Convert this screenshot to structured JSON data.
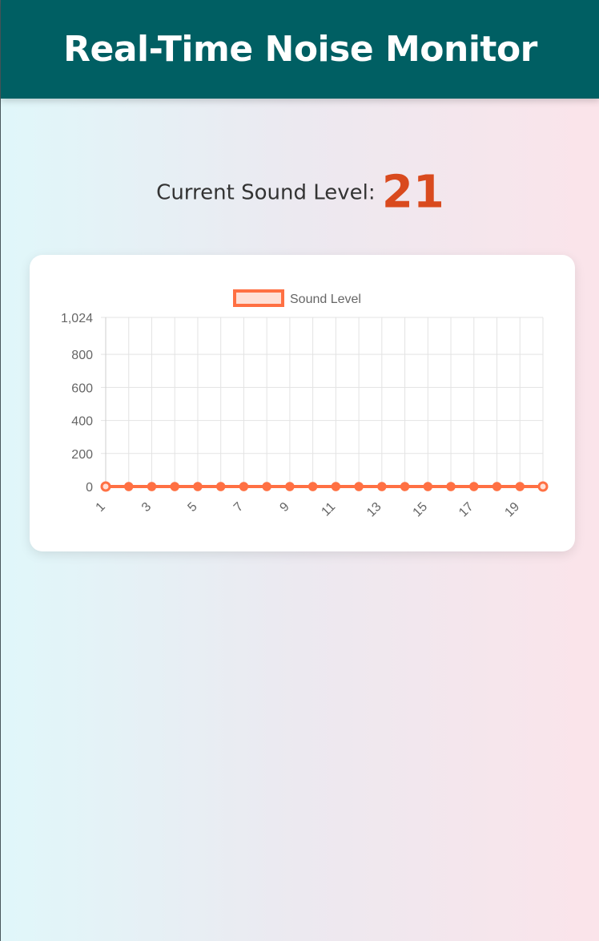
{
  "header": {
    "title": "Real-Time Noise Monitor"
  },
  "level": {
    "label": "Current Sound Level:",
    "value": "21"
  },
  "colors": {
    "header_bg": "#005f63",
    "accent": "#d94a1e",
    "series_line": "#ff7043",
    "series_fill": "#ffe0d6"
  },
  "chart_data": {
    "type": "line",
    "title": "",
    "xlabel": "",
    "ylabel": "",
    "x": [
      1,
      2,
      3,
      4,
      5,
      6,
      7,
      8,
      9,
      10,
      11,
      12,
      13,
      14,
      15,
      16,
      17,
      18,
      19,
      20
    ],
    "x_tick_labels": [
      "1",
      "3",
      "5",
      "7",
      "9",
      "11",
      "13",
      "15",
      "17",
      "19"
    ],
    "y_tick_labels": [
      "0",
      "200",
      "400",
      "600",
      "800",
      "1,024"
    ],
    "y_ticks": [
      0,
      200,
      400,
      600,
      800,
      1024
    ],
    "ylim": [
      0,
      1024
    ],
    "grid": true,
    "legend_position": "top",
    "series": [
      {
        "name": "Sound Level",
        "values": [
          0,
          0,
          0,
          0,
          0,
          0,
          0,
          0,
          0,
          0,
          0,
          0,
          0,
          0,
          0,
          0,
          0,
          0,
          0,
          0
        ]
      }
    ]
  }
}
